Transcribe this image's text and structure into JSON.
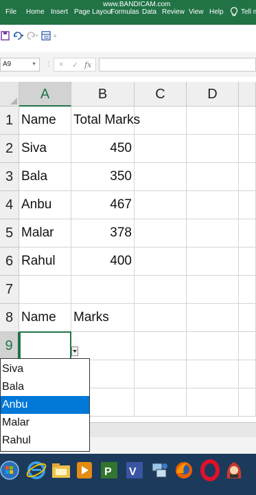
{
  "ribbon": {
    "tabs": [
      "File",
      "Home",
      "Insert",
      "Page Layout",
      "Formulas",
      "Data",
      "Review",
      "View",
      "Help",
      "Tell m"
    ],
    "watermark": "www.BANDICAM.com"
  },
  "formula_bar": {
    "name_box": "A9",
    "cancel_symbol": "×",
    "enter_symbol": "✓",
    "function_symbol": "fx",
    "value": ""
  },
  "columns": [
    "A",
    "B",
    "C",
    "D"
  ],
  "rows": [
    "1",
    "2",
    "3",
    "4",
    "5",
    "6",
    "7",
    "8",
    "9"
  ],
  "cells": {
    "A1": "Name",
    "B1": "Total Marks",
    "A2": "Siva",
    "B2": "450",
    "A3": "Bala",
    "B3": "350",
    "A4": "Anbu",
    "B4": "467",
    "A5": "Malar",
    "B5": "378",
    "A6": "Rahul",
    "B6": "400",
    "A8": "Name",
    "B8": "Marks"
  },
  "validation_list": {
    "items": [
      "Siva",
      "Bala",
      "Anbu",
      "Malar",
      "Rahul"
    ],
    "highlighted": "Anbu"
  },
  "colors": {
    "excel_green": "#217346",
    "highlight_blue": "#0078d7",
    "taskbar": "#1c3a5c"
  },
  "taskbar_icons": [
    "windows-start-icon",
    "internet-explorer-icon",
    "file-explorer-icon",
    "media-player-icon",
    "project-icon",
    "visio-icon",
    "network-icon",
    "firefox-icon",
    "opera-icon",
    "app-icon"
  ]
}
